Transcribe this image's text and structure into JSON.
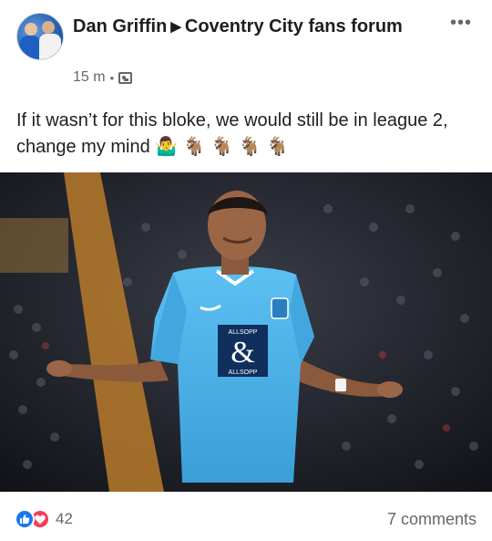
{
  "post": {
    "author": "Dan Griffin",
    "group": "Coventry City fans forum",
    "time": "15 m",
    "separator": "•",
    "text": "If it wasn’t for this bloke, we would still be in league 2, change my mind 🤷‍♂️ 🐐 🐐 🐐 🐐",
    "more_label": "•••"
  },
  "photo": {
    "sponsor_top": "ALLSOPP",
    "sponsor_mark": "&",
    "sponsor_bottom": "ALLSOPP"
  },
  "footer": {
    "reaction_count": "42",
    "comments": "7 comments"
  },
  "colors": {
    "like": "#1877f2",
    "love": "#f33e58",
    "shirt": "#4fb3ea"
  }
}
